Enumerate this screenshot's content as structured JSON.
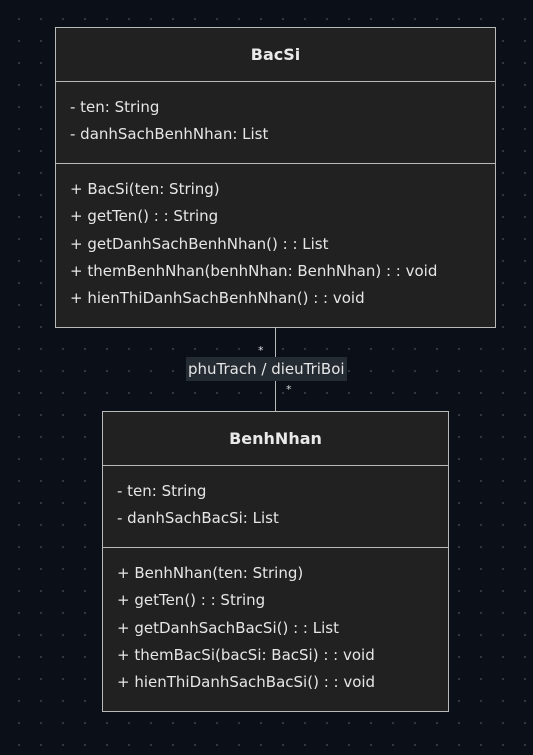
{
  "classes": {
    "bacsi": {
      "name": "BacSi",
      "attributes": [
        "- ten: String",
        "- danhSachBenhNhan: List"
      ],
      "methods": [
        "+ BacSi(ten: String)",
        "+ getTen() : : String",
        "+ getDanhSachBenhNhan() : : List",
        "+ themBenhNhan(benhNhan: BenhNhan) : : void",
        "+ hienThiDanhSachBenhNhan() : : void"
      ]
    },
    "benhnhan": {
      "name": "BenhNhan",
      "attributes": [
        "- ten: String",
        "- danhSachBacSi: List"
      ],
      "methods": [
        "+ BenhNhan(ten: String)",
        "+ getTen() : : String",
        "+ getDanhSachBacSi() : : List",
        "+ themBacSi(bacSi: BacSi) : : void",
        "+ hienThiDanhSachBacSi() : : void"
      ]
    }
  },
  "association": {
    "label": "phuTrach / dieuTriBoi",
    "multiplicity_source": "*",
    "multiplicity_target": "*"
  },
  "colors": {
    "background": "#0b0f17",
    "box_fill": "#212121",
    "box_border": "#b9b9b9",
    "text": "#e6e6e6",
    "label_bg": "#252b33"
  }
}
